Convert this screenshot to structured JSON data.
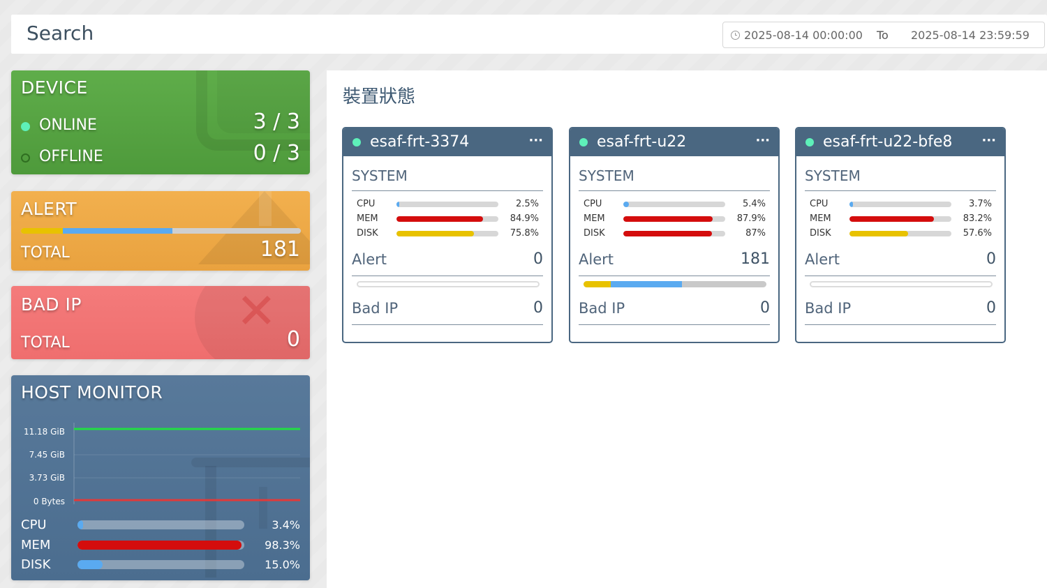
{
  "search": {
    "title": "Search",
    "from": "2025-08-14 00:00:00",
    "to_label": "To",
    "to": "2025-08-14 23:59:59"
  },
  "colors": {
    "online": "#5ef0b9",
    "cpu": "#5aaaf0",
    "mem": "#d40d0d",
    "disk": "#e8c200",
    "alert_yellow": "#e8c200",
    "alert_blue": "#5aaaf0"
  },
  "device": {
    "title": "DEVICE",
    "online_label": "ONLINE",
    "online_value": "3 / 3",
    "offline_label": "OFFLINE",
    "offline_value": "0 / 3"
  },
  "alert": {
    "title": "ALERT",
    "total_label": "TOTAL",
    "total_value": "181",
    "segments": [
      {
        "color": "#e8c200",
        "percent": 15
      },
      {
        "color": "#5aaaf0",
        "percent": 39
      }
    ]
  },
  "badip": {
    "title": "BAD IP",
    "total_label": "TOTAL",
    "total_value": "0"
  },
  "host": {
    "title": "HOST MONITOR",
    "chart_ticks": [
      "11.18 GiB",
      "7.45 GiB",
      "3.73 GiB",
      "0 Bytes"
    ],
    "lines": [
      {
        "color": "#22dd44",
        "value": 11.18
      },
      {
        "color": "#e03a3a",
        "value": 0
      }
    ],
    "metrics": [
      {
        "label": "CPU",
        "value": "3.4%",
        "percent": 3.4,
        "color": "#5aaaf0"
      },
      {
        "label": "MEM",
        "value": "98.3%",
        "percent": 98.3,
        "color": "#d40d0d"
      },
      {
        "label": "DISK",
        "value": "15.0%",
        "percent": 15.0,
        "color": "#5aaaf0"
      }
    ]
  },
  "main": {
    "title": "裝置狀態"
  },
  "devices": [
    {
      "name": "esaf-frt-3374",
      "menu": "···",
      "section": "SYSTEM",
      "metrics": [
        {
          "label": "CPU",
          "value": "2.5%",
          "percent": 2.5,
          "color": "#5aaaf0"
        },
        {
          "label": "MEM",
          "value": "84.9%",
          "percent": 84.9,
          "color": "#d40d0d"
        },
        {
          "label": "DISK",
          "value": "75.8%",
          "percent": 75.8,
          "color": "#e8c200"
        }
      ],
      "alert_label": "Alert",
      "alert_value": "0",
      "alert_segments": [],
      "badip_label": "Bad IP",
      "badip_value": "0"
    },
    {
      "name": "esaf-frt-u22",
      "menu": "···",
      "section": "SYSTEM",
      "metrics": [
        {
          "label": "CPU",
          "value": "5.4%",
          "percent": 5.4,
          "color": "#5aaaf0"
        },
        {
          "label": "MEM",
          "value": "87.9%",
          "percent": 87.9,
          "color": "#d40d0d"
        },
        {
          "label": "DISK",
          "value": "87%",
          "percent": 87,
          "color": "#d40d0d"
        }
      ],
      "alert_label": "Alert",
      "alert_value": "181",
      "alert_segments": [
        {
          "color": "#e8c200",
          "percent": 15
        },
        {
          "color": "#5aaaf0",
          "percent": 39
        }
      ],
      "badip_label": "Bad IP",
      "badip_value": "0"
    },
    {
      "name": "esaf-frt-u22-bfe8",
      "menu": "···",
      "section": "SYSTEM",
      "metrics": [
        {
          "label": "CPU",
          "value": "3.7%",
          "percent": 3.7,
          "color": "#5aaaf0"
        },
        {
          "label": "MEM",
          "value": "83.2%",
          "percent": 83.2,
          "color": "#d40d0d"
        },
        {
          "label": "DISK",
          "value": "57.6%",
          "percent": 57.6,
          "color": "#e8c200"
        }
      ],
      "alert_label": "Alert",
      "alert_value": "0",
      "alert_segments": [],
      "badip_label": "Bad IP",
      "badip_value": "0"
    }
  ]
}
